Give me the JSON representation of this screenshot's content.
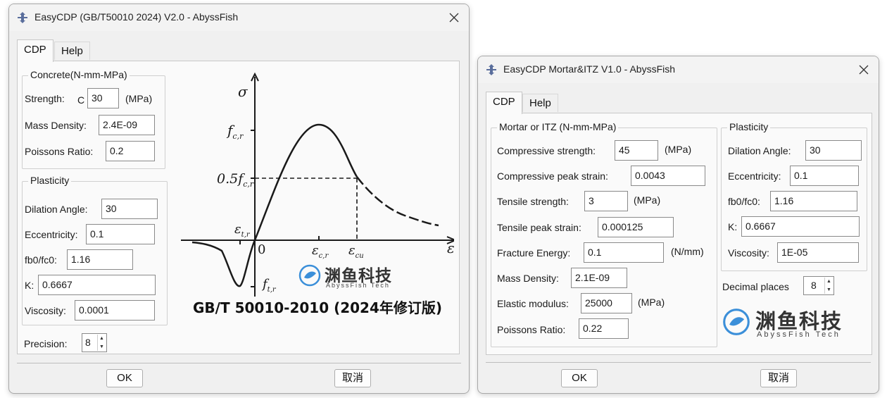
{
  "win1": {
    "title": "EasyCDP (GB/T50010 2024) V2.0 - AbyssFish",
    "tabs": [
      "CDP",
      "Help"
    ],
    "concrete": {
      "title": "Concrete(N-mm-MPa)",
      "strength_label": "Strength:",
      "strength_prefix": "C",
      "strength_value": "30",
      "strength_unit": "(MPa)",
      "density_label": "Mass Density:",
      "density_value": "2.4E-09",
      "poisson_label": "Poissons Ratio:",
      "poisson_value": "0.2"
    },
    "plasticity": {
      "title": "Plasticity",
      "dilation_label": "Dilation Angle:",
      "dilation_value": "30",
      "ecc_label": "Eccentricity:",
      "ecc_value": "0.1",
      "fb_label": "fb0/fc0:",
      "fb_value": "1.16",
      "k_label": "K:",
      "k_value": "0.6667",
      "visc_label": "Viscosity:",
      "visc_value": "0.0001"
    },
    "precision_label": "Precision:",
    "precision_value": "8",
    "diagram": {
      "sigma": "σ",
      "fcr": "f",
      "fcr_sub": "c,r",
      "half_fcr": "0.5f",
      "half_fcr_sub": "c,r",
      "etr": "ε",
      "etr_sub": "t,r",
      "zero": "0",
      "ecr": "ε",
      "ecr_sub": "c,r",
      "ecu": "ε",
      "ecu_sub": "cu",
      "eps": "ε",
      "ftr": "f",
      "ftr_sub": "t,r"
    },
    "logo_cn": "渊鱼科技",
    "logo_en": "AbyssFish Tech",
    "standard_caption": "GB/T 50010-2010 (2024年修订版)",
    "ok": "OK",
    "cancel": "取消"
  },
  "win2": {
    "title": "EasyCDP Mortar&ITZ V1.0 - AbyssFish",
    "tabs": [
      "CDP",
      "Help"
    ],
    "mortar": {
      "title": "Mortar or ITZ (N-mm-MPa)",
      "cs_label": "Compressive strength:",
      "cs_value": "45",
      "cs_unit": "(MPa)",
      "cps_label": "Compressive peak strain:",
      "cps_value": "0.0043",
      "ts_label": "Tensile strength:",
      "ts_value": "3",
      "ts_unit": "(MPa)",
      "tps_label": "Tensile peak strain:",
      "tps_value": "0.000125",
      "fe_label": "Fracture Energy:",
      "fe_value": "0.1",
      "fe_unit": "(N/mm)",
      "md_label": "Mass Density:",
      "md_value": "2.1E-09",
      "em_label": "Elastic modulus:",
      "em_value": "25000",
      "em_unit": "(MPa)",
      "pr_label": "Poissons Ratio:",
      "pr_value": "0.22"
    },
    "plasticity": {
      "title": "Plasticity",
      "dilation_label": "Dilation Angle:",
      "dilation_value": "30",
      "ecc_label": "Eccentricity:",
      "ecc_value": "0.1",
      "fb_label": "fb0/fc0:",
      "fb_value": "1.16",
      "k_label": "K:",
      "k_value": "0.6667",
      "visc_label": "Viscosity:",
      "visc_value": "1E-05"
    },
    "decimal_label": "Decimal places",
    "decimal_value": "8",
    "logo_cn": "渊鱼科技",
    "logo_en": "AbyssFish Tech",
    "ok": "OK",
    "cancel": "取消"
  }
}
